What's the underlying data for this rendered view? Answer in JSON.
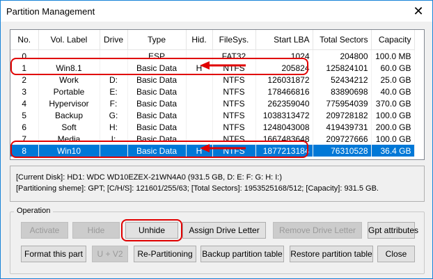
{
  "window": {
    "title": "Partition Management",
    "close_glyph": "✕"
  },
  "table": {
    "headers": [
      "No.",
      "Vol. Label",
      "Drive",
      "Type",
      "Hid.",
      "FileSys.",
      "Start LBA",
      "Total Sectors",
      "Capacity"
    ],
    "rows": [
      [
        "0",
        "",
        "",
        "ESP",
        "",
        "FAT32",
        "1024",
        "204800",
        "100.0 MB"
      ],
      [
        "1",
        "Win8.1",
        "",
        "Basic Data",
        "H",
        "NTFS",
        "205824",
        "125824101",
        "60.0 GB"
      ],
      [
        "2",
        "Work",
        "D:",
        "Basic Data",
        "",
        "NTFS",
        "126031872",
        "52434212",
        "25.0 GB"
      ],
      [
        "3",
        "Portable",
        "E:",
        "Basic Data",
        "",
        "NTFS",
        "178466816",
        "83890698",
        "40.0 GB"
      ],
      [
        "4",
        "Hypervisor",
        "F:",
        "Basic Data",
        "",
        "NTFS",
        "262359040",
        "775954039",
        "370.0 GB"
      ],
      [
        "5",
        "Backup",
        "G:",
        "Basic Data",
        "",
        "NTFS",
        "1038313472",
        "209728182",
        "100.0 GB"
      ],
      [
        "6",
        "Soft",
        "H:",
        "Basic Data",
        "",
        "NTFS",
        "1248043008",
        "419439731",
        "200.0 GB"
      ],
      [
        "7",
        "Media",
        "I:",
        "Basic Data",
        "",
        "NTFS",
        "1667483648",
        "209727666",
        "100.0 GB"
      ],
      [
        "8",
        "Win10",
        "",
        "Basic Data",
        "H",
        "NTFS",
        "1877213184",
        "76310528",
        "36.4 GB"
      ]
    ],
    "selected_row": 8
  },
  "info": {
    "line1": "[Current Disk]:  HD1: WDC WD10EZEX-21WN4A0 (931.5 GB, D: E: F: G: H: I:)",
    "line2": "[Partitioning sheme]:    GPT;      [C/H/S]:  121601/255/63;  [Total Sectors]:  1953525168/512;  [Capacity]:  931.5 GB."
  },
  "operation": {
    "label": "Operation",
    "row1": {
      "activate": "Activate",
      "hide": "Hide",
      "unhide": "Unhide",
      "assign_letter": "Assign Drive Letter",
      "remove_letter": "Remove Drive Letter",
      "gpt_attributes": "Gpt attributes"
    },
    "row2": {
      "format": "Format this part",
      "uv2": "U + V2",
      "repartition": "Re-Partitioning",
      "backup_table": "Backup partition table",
      "restore_table": "Restore partition table",
      "close": "Close"
    }
  },
  "colors": {
    "selection": "#0078d7",
    "annotation": "#e00000"
  }
}
